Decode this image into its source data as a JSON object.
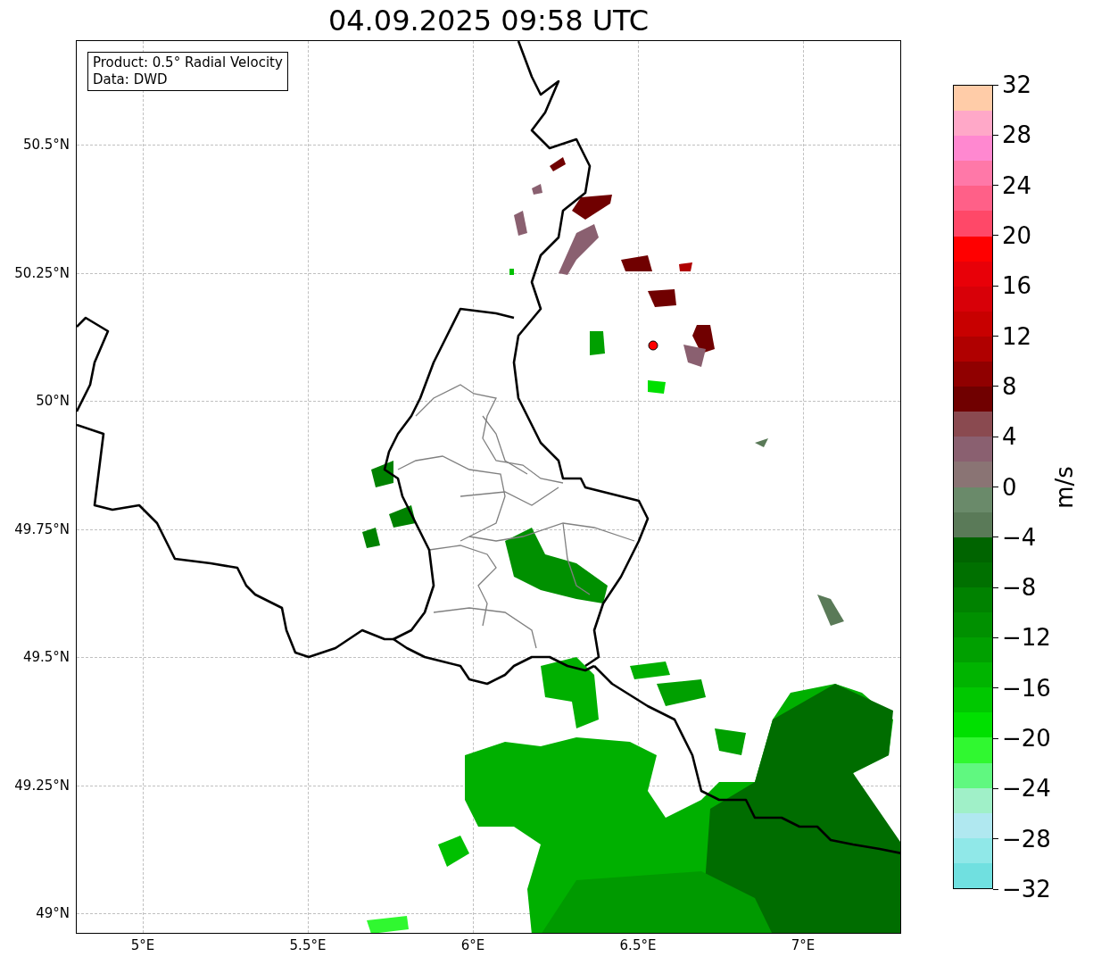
{
  "title": "04.09.2025 09:58 UTC",
  "info_box": {
    "lines": [
      "Product: 0.5° Radial Velocity",
      "Data: DWD"
    ]
  },
  "map": {
    "x_ticks": [
      "5°E",
      "5.5°E",
      "6°E",
      "6.5°E",
      "7°E"
    ],
    "y_ticks": [
      "50.5°N",
      "50.25°N",
      "50°N",
      "49.75°N",
      "49.5°N",
      "49.25°N",
      "49°N"
    ]
  },
  "colorbar": {
    "label": "m/s",
    "ticks": [
      "32",
      "28",
      "24",
      "20",
      "16",
      "12",
      "8",
      "4",
      "0",
      "−4",
      "−8",
      "−12",
      "−16",
      "−20",
      "−24",
      "−28",
      "−32"
    ],
    "segments": [
      {
        "color": "#ffcca8"
      },
      {
        "color": "#ffa8c8"
      },
      {
        "color": "#ff88d0"
      },
      {
        "color": "#ff78a8"
      },
      {
        "color": "#ff6088"
      },
      {
        "color": "#ff4868"
      },
      {
        "color": "#ff0000"
      },
      {
        "color": "#e80008"
      },
      {
        "color": "#d80008"
      },
      {
        "color": "#c80000"
      },
      {
        "color": "#b00000"
      },
      {
        "color": "#900000"
      },
      {
        "color": "#700000"
      },
      {
        "color": "#8a4a50"
      },
      {
        "color": "#8a6070"
      },
      {
        "color": "#8a7474"
      },
      {
        "color": "#6a8a6a"
      },
      {
        "color": "#5a7a58"
      },
      {
        "color": "#006400"
      },
      {
        "color": "#007000"
      },
      {
        "color": "#008200"
      },
      {
        "color": "#009000"
      },
      {
        "color": "#00a000"
      },
      {
        "color": "#00b400"
      },
      {
        "color": "#00c800"
      },
      {
        "color": "#00e000"
      },
      {
        "color": "#30f830"
      },
      {
        "color": "#60f880"
      },
      {
        "color": "#a0f0c8"
      },
      {
        "color": "#b0e8f0"
      },
      {
        "color": "#90e8e8"
      },
      {
        "color": "#70e0e0"
      }
    ]
  }
}
